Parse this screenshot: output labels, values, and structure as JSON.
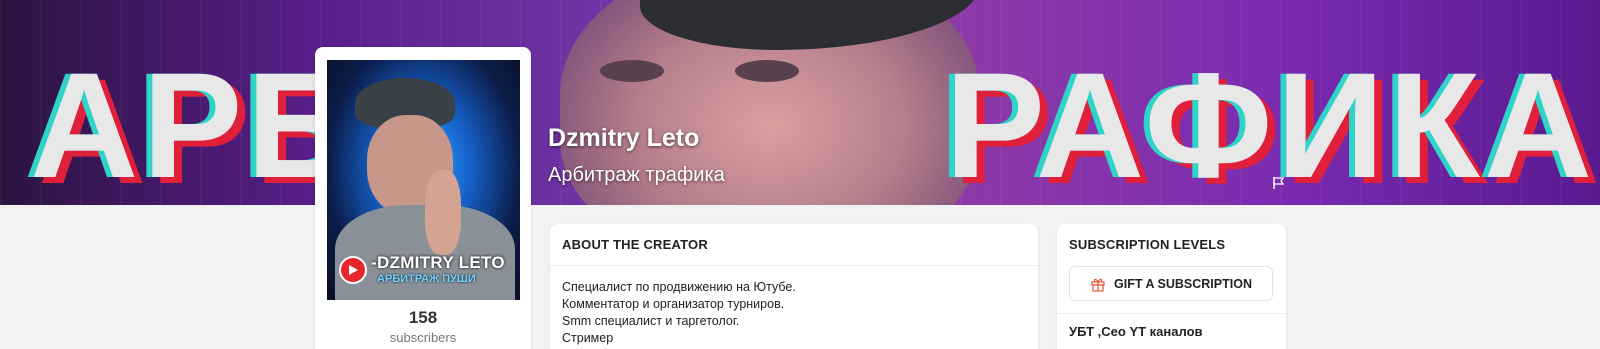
{
  "cover": {
    "creator_name": "Dzmitry Leto",
    "tagline": "Арбитраж трафика",
    "banner_text_left": "АРБ",
    "banner_text_right": "РАФИКА",
    "report_icon": "flag-icon"
  },
  "profile": {
    "avatar_title": "-DZMITRY LETO",
    "avatar_subtitle": "АРБИТРАЖ ПУШИ",
    "subscribers_count": "158",
    "subscribers_label": "subscribers"
  },
  "about": {
    "heading": "ABOUT THE CREATOR",
    "lines": [
      "Специалист по продвижению на Ютубе.",
      "Комментатор и организатор турниров.",
      "Smm специалист и таргетолог.",
      "Стример"
    ]
  },
  "subscription_levels": {
    "heading": "SUBSCRIPTION LEVELS",
    "gift_button_label": "GIFT A SUBSCRIPTION",
    "gift_icon": "gift-icon",
    "gift_icon_color": "#e2563b",
    "levels": [
      {
        "name": "УБТ ,Сео YT каналов"
      }
    ]
  }
}
